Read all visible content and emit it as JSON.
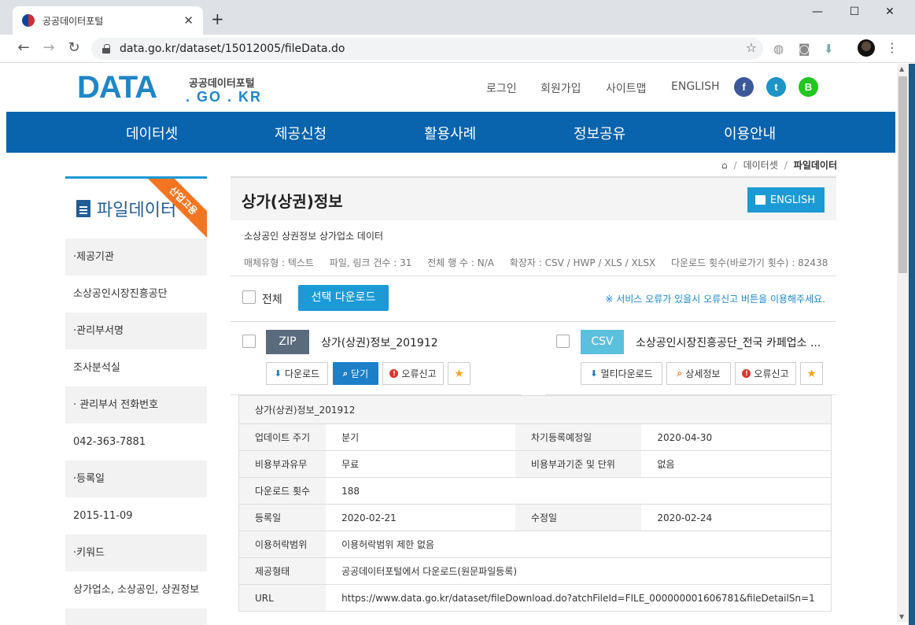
{
  "browser": {
    "tab_title": "공공데이터포털",
    "tab_close": "✕",
    "new_tab": "+",
    "url": "data.go.kr/dataset/15012005/fileData.do",
    "win_min": "—",
    "win_max": "☐",
    "win_close": "✕",
    "back": "←",
    "forward": "→",
    "reload": "↻",
    "bookmark_star": "☆",
    "globe_ext": "◍",
    "camera_ext": "◙",
    "download_ext": "⬇",
    "menu": "⋮"
  },
  "header": {
    "logo_main": "DATA",
    "logo_kr": "공공데이터포털",
    "logo_domain": ". GO . KR",
    "nav": [
      "로그인",
      "회원가입",
      "사이트맵",
      "ENGLISH"
    ],
    "social": [
      {
        "glyph": "f",
        "color": "#3b5998"
      },
      {
        "glyph": "t",
        "color": "#1c94c6"
      },
      {
        "glyph": "B",
        "color": "#23c520"
      }
    ]
  },
  "main_nav": [
    "데이터셋",
    "제공신청",
    "활용사례",
    "정보공유",
    "이용안내"
  ],
  "breadcrumb": {
    "home": "⌂",
    "sep": "/",
    "level1": "데이터셋",
    "current": "파일데이터"
  },
  "sidebar": {
    "title": "파일데이터",
    "ribbon": "산업고용",
    "fields": [
      {
        "label": "·제공기관",
        "value": "소상공인시장진흥공단"
      },
      {
        "label": "·관리부서명",
        "value": "조사분석실"
      },
      {
        "label": "· 관리부서 전화번호",
        "value": "042-363-7881"
      },
      {
        "label": "·등록일",
        "value": "2015-11-09"
      },
      {
        "label": "·키워드",
        "value": "상가업소, 소상공인, 상권정보"
      }
    ]
  },
  "dataset": {
    "title": "상가(상권)정보",
    "english_btn": "ENGLISH",
    "subtitle": "소상공인 상권정보 상가업소 데이터",
    "meta": [
      "매체유형 : 텍스트",
      "파일, 링크 건수 : 31",
      "전체 행 수 : N/A",
      "확장자 : CSV / HWP / XLS / XLSX",
      "다운로드 횟수(바로가기 횟수) : 82438"
    ],
    "select_all": "전체",
    "select_download": "선택 다운로드",
    "notice": "※ 서비스 오류가 있을시 오류신고 버튼을 이용해주세요.",
    "files": [
      {
        "format": "ZIP",
        "format_color": "#5a6b7d",
        "name": "상가(상권)정보_201912",
        "buttons": {
          "download": "다운로드",
          "close": "닫기",
          "report": "오류신고"
        }
      },
      {
        "format": "CSV",
        "format_color": "#5bc0de",
        "name": "소상공인시장진흥공단_전국 카페업소 ...",
        "buttons": {
          "multi_download": "멀티다운로드",
          "detail": "상세정보",
          "report": "오류신고"
        }
      }
    ],
    "icons": {
      "download": "⬇",
      "search": "⌕",
      "error": "!",
      "star": "★"
    }
  },
  "detail": {
    "caption": "상가(상권)정보_201912",
    "rows": {
      "update_cycle": {
        "label": "업데이트 주기",
        "value": "분기"
      },
      "next_reg": {
        "label": "차기등록예정일",
        "value": "2020-04-30"
      },
      "fee": {
        "label": "비용부과유무",
        "value": "무료"
      },
      "fee_basis": {
        "label": "비용부과기준 및 단위",
        "value": "없음"
      },
      "downloads": {
        "label": "다운로드 횟수",
        "value": "188"
      },
      "registered": {
        "label": "등록일",
        "value": "2020-02-21"
      },
      "modified": {
        "label": "수정일",
        "value": "2020-02-24"
      },
      "license": {
        "label": "이용허락범위",
        "value": "이용허락범위 제한 없음"
      },
      "provision": {
        "label": "제공형태",
        "value": "공공데이터포털에서 다운로드(원문파일등록)"
      },
      "url": {
        "label": "URL",
        "value": "https://www.data.go.kr/dataset/fileDownload.do?atchFileId=FILE_000000001606781&fileDetailSn=1"
      }
    }
  }
}
